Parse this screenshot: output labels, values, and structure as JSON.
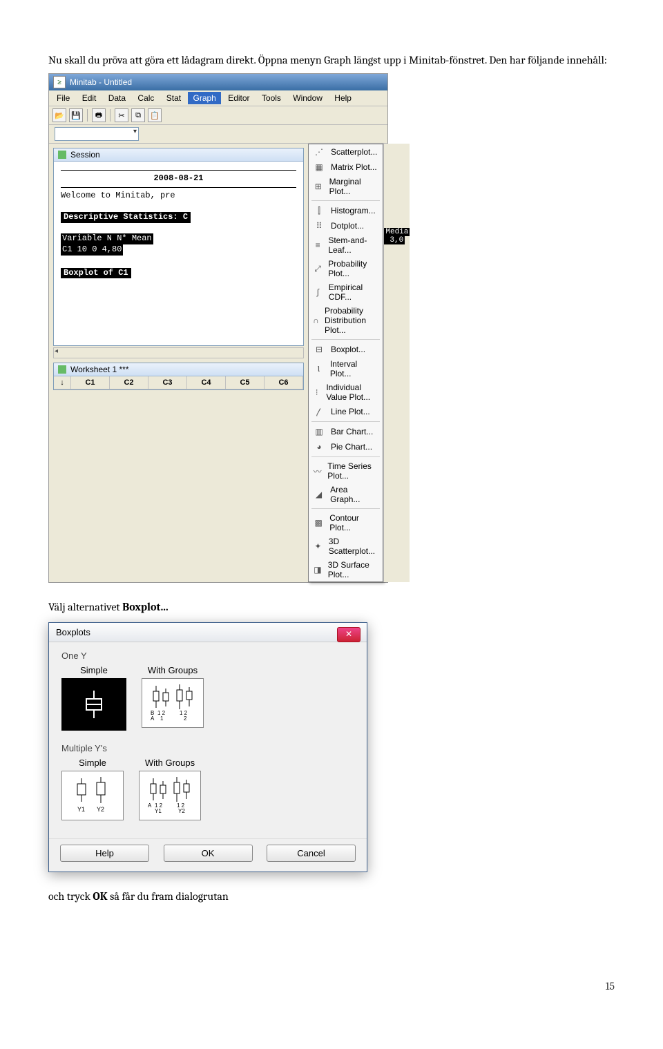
{
  "intro_text": "Nu skall du pröva att göra ett lådagram direkt. Öppna menyn Graph längst upp i Minitab-fönstret. Den har följande innehåll:",
  "minitab": {
    "title": "Minitab - Untitled",
    "menus": [
      "File",
      "Edit",
      "Data",
      "Calc",
      "Stat",
      "Graph",
      "Editor",
      "Tools",
      "Window",
      "Help"
    ],
    "active_menu_index": 5,
    "session_label": "Session",
    "session_date": "2008-08-21",
    "welcome_line": "Welcome to Minitab, pre",
    "descriptive_header": "Descriptive Statistics: C",
    "var_header": "Variable   N  N*  Mean",
    "var_line": "C1        10   0  4,80",
    "right_header": "Media",
    "right_line": "3,0",
    "boxplot_label": "Boxplot of C1",
    "worksheet_label": "Worksheet 1 ***",
    "columns": [
      "C1",
      "C2",
      "C3",
      "C4",
      "C5",
      "C6"
    ],
    "arrow": "↓",
    "graph_menu": [
      {
        "icon": "⋰",
        "label": "Scatterplot..."
      },
      {
        "icon": "▦",
        "label": "Matrix Plot..."
      },
      {
        "icon": "⊞",
        "label": "Marginal Plot..."
      },
      {
        "sep": true
      },
      {
        "icon": "⫿",
        "label": "Histogram..."
      },
      {
        "icon": "⠿",
        "label": "Dotplot..."
      },
      {
        "icon": "≡",
        "label": "Stem-and-Leaf..."
      },
      {
        "icon": "⤢",
        "label": "Probability Plot..."
      },
      {
        "icon": "∫",
        "label": "Empirical CDF..."
      },
      {
        "icon": "∩",
        "label": "Probability Distribution Plot..."
      },
      {
        "sep": true
      },
      {
        "icon": "⊟",
        "label": "Boxplot..."
      },
      {
        "icon": "Ⲓ",
        "label": "Interval Plot..."
      },
      {
        "icon": "⁝",
        "label": "Individual Value Plot..."
      },
      {
        "icon": "〳",
        "label": "Line Plot..."
      },
      {
        "sep": true
      },
      {
        "icon": "▥",
        "label": "Bar Chart..."
      },
      {
        "icon": "◕",
        "label": "Pie Chart..."
      },
      {
        "sep": true
      },
      {
        "icon": "〰",
        "label": "Time Series Plot..."
      },
      {
        "icon": "◢",
        "label": "Area Graph..."
      },
      {
        "sep": true
      },
      {
        "icon": "▩",
        "label": "Contour Plot..."
      },
      {
        "icon": "✦",
        "label": "3D Scatterplot..."
      },
      {
        "icon": "◨",
        "label": "3D Surface Plot..."
      }
    ]
  },
  "mid_text": "Välj alternativet Boxplot...",
  "dialog": {
    "title": "Boxplots",
    "one_y": "One Y",
    "multiple_y": "Multiple Y's",
    "simple": "Simple",
    "with_groups": "With Groups",
    "axis_b": "B",
    "axis_a": "A",
    "axis_12a": "1  2",
    "axis_12b": "1  2",
    "y1": "Y1",
    "y2": "Y2",
    "help": "Help",
    "ok": "OK",
    "cancel": "Cancel"
  },
  "outro_text": "och tryck OK så får du fram dialogrutan",
  "page_number": "15"
}
